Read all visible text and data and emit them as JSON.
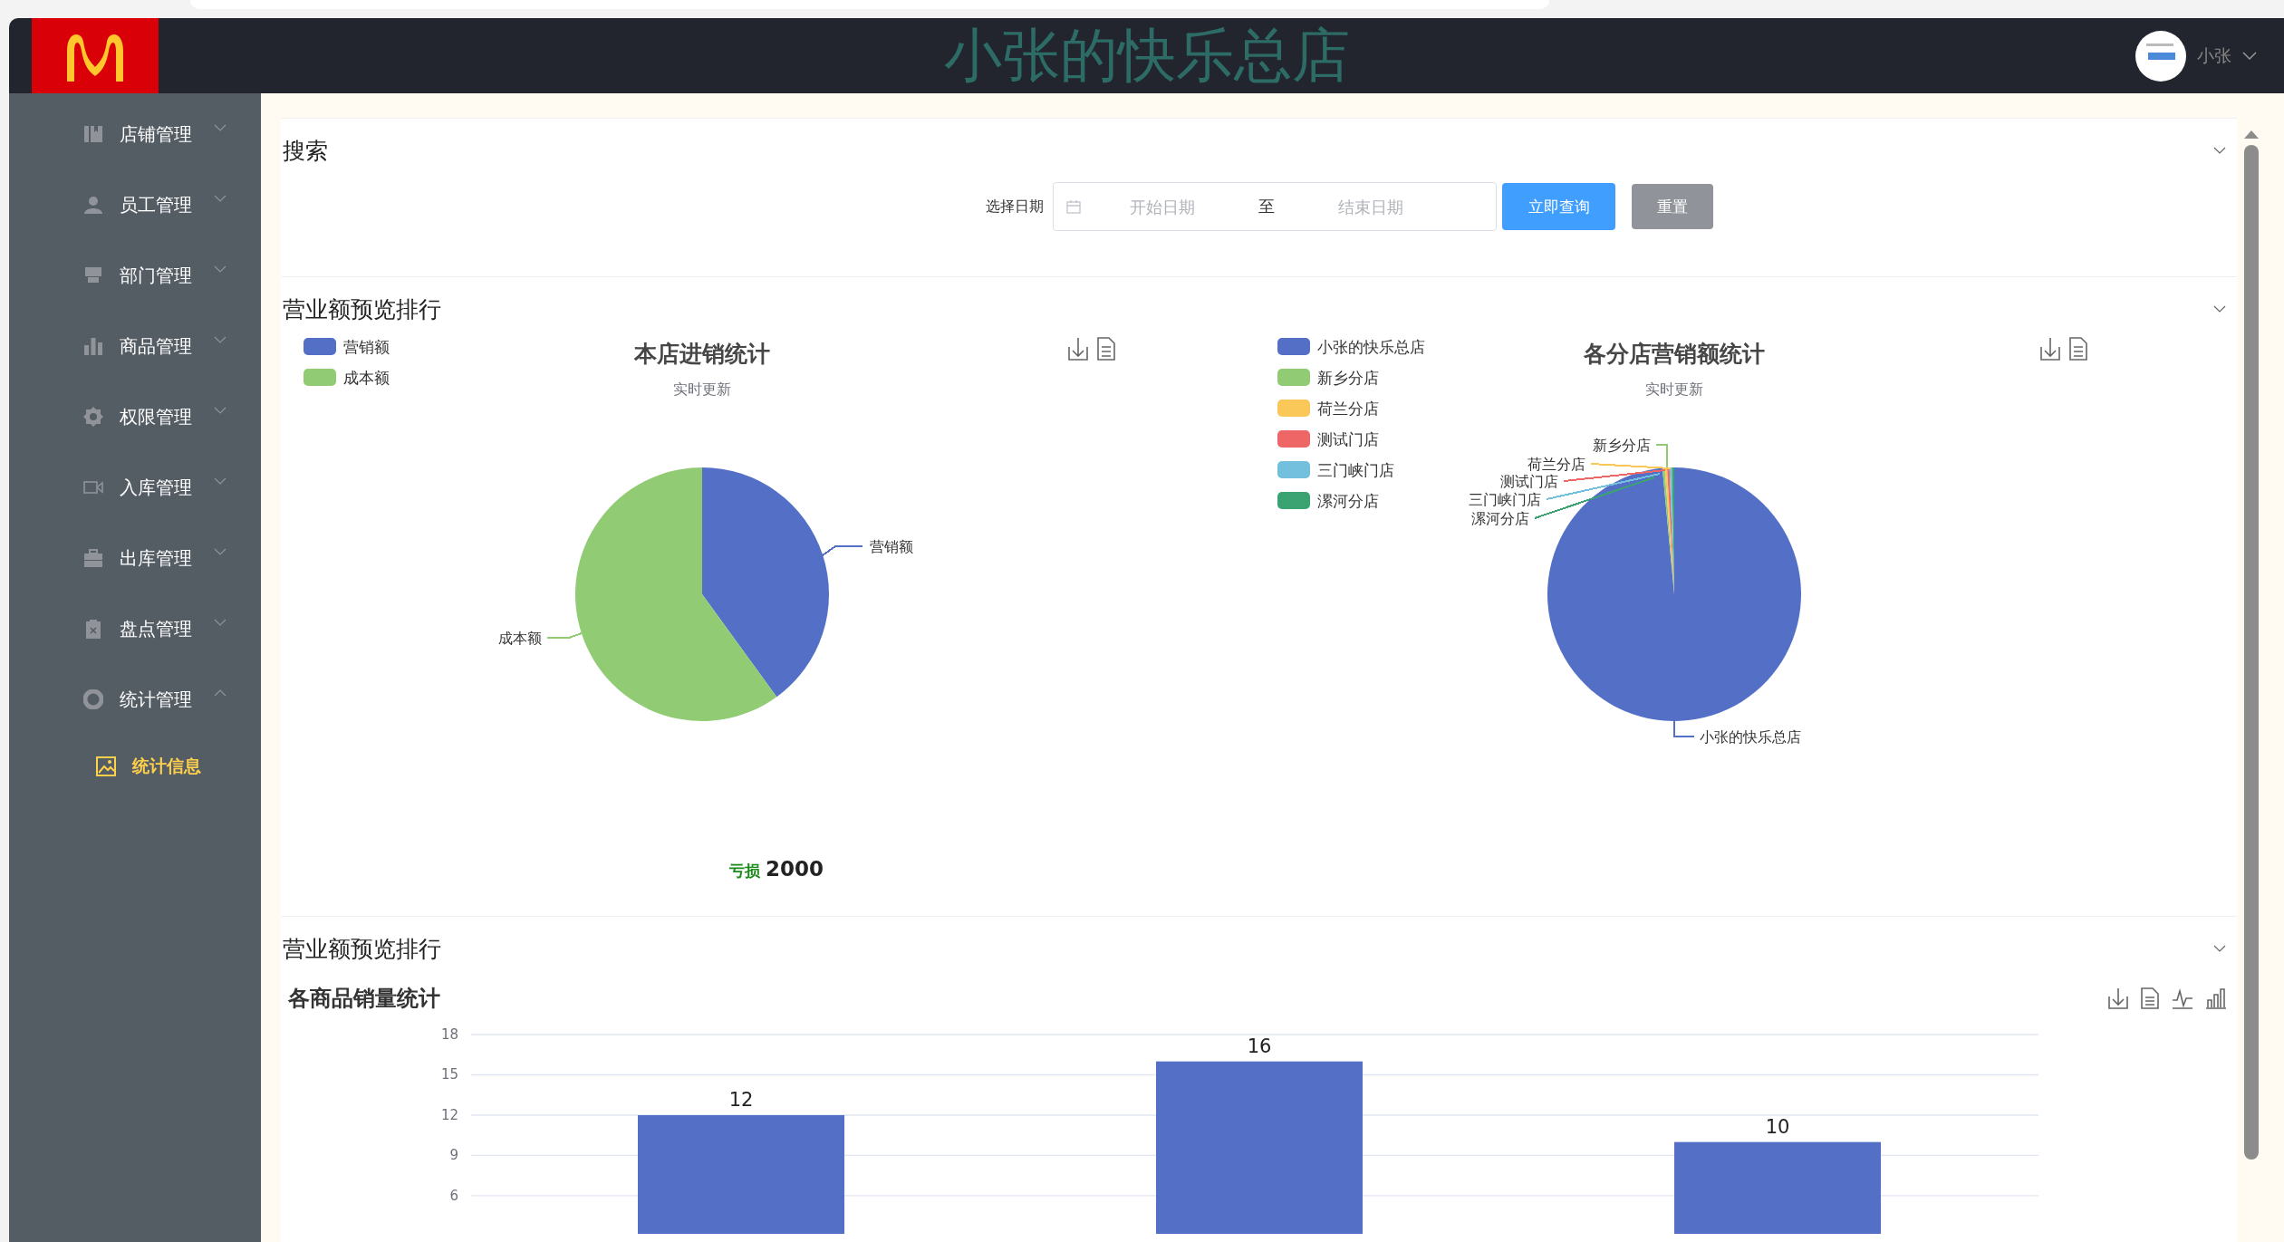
{
  "header": {
    "title": "小张的快乐总店",
    "user": "小张"
  },
  "sidebar": {
    "items": [
      {
        "label": "店铺管理",
        "expanded": false
      },
      {
        "label": "员工管理",
        "expanded": false
      },
      {
        "label": "部门管理",
        "expanded": false
      },
      {
        "label": "商品管理",
        "expanded": false
      },
      {
        "label": "权限管理",
        "expanded": false
      },
      {
        "label": "入库管理",
        "expanded": false
      },
      {
        "label": "出库管理",
        "expanded": false
      },
      {
        "label": "盘点管理",
        "expanded": false
      },
      {
        "label": "统计管理",
        "expanded": true,
        "children": [
          {
            "label": "统计信息",
            "selected": true
          }
        ]
      }
    ]
  },
  "search": {
    "title": "搜索",
    "date_label": "选择日期",
    "start_placeholder": "开始日期",
    "separator": "至",
    "end_placeholder": "结束日期",
    "buttons": [
      {
        "label": "立即查询",
        "kind": "primary"
      },
      {
        "label": "重置",
        "kind": "secondary"
      }
    ]
  },
  "overview": {
    "title": "营业额预览排行",
    "charts": [
      {
        "title": "本店进销统计",
        "subtitle": "实时更新",
        "legend": [
          {
            "label": "营销额",
            "color": "#5470c6"
          },
          {
            "label": "成本额",
            "color": "#91cc75"
          }
        ],
        "slice_labels": [
          {
            "label": "营销额",
            "color": "#5470c6"
          },
          {
            "label": "成本额",
            "color": "#91cc75"
          }
        ]
      },
      {
        "title": "各分店营销额统计",
        "subtitle": "实时更新",
        "legend": [
          {
            "label": "小张的快乐总店",
            "color": "#5470c6"
          },
          {
            "label": "新乡分店",
            "color": "#91cc75"
          },
          {
            "label": "荷兰分店",
            "color": "#fac858"
          },
          {
            "label": "测试门店",
            "color": "#ee6666"
          },
          {
            "label": "三门峡门店",
            "color": "#73c0de"
          },
          {
            "label": "漯河分店",
            "color": "#3ba272"
          }
        ],
        "slice_labels": [
          {
            "label": "小张的快乐总店",
            "color": "#5470c6"
          },
          {
            "label": "新乡分店",
            "color": "#91cc75"
          },
          {
            "label": "荷兰分店",
            "color": "#fac858"
          },
          {
            "label": "测试门店",
            "color": "#ee6666"
          },
          {
            "label": "三门峡门店",
            "color": "#73c0de"
          },
          {
            "label": "漯河分店",
            "color": "#3ba272"
          }
        ]
      }
    ],
    "result": {
      "label": "亏损",
      "value": "2000"
    }
  },
  "sales": {
    "title": "营业额预览排行",
    "chart_data": {
      "type": "bar",
      "title": "各商品销量统计",
      "values": [
        12,
        16,
        10
      ],
      "ylim": [
        0,
        18
      ],
      "yticks": [
        6,
        9,
        12,
        15,
        18
      ],
      "grid": true,
      "data_labels": true
    }
  }
}
